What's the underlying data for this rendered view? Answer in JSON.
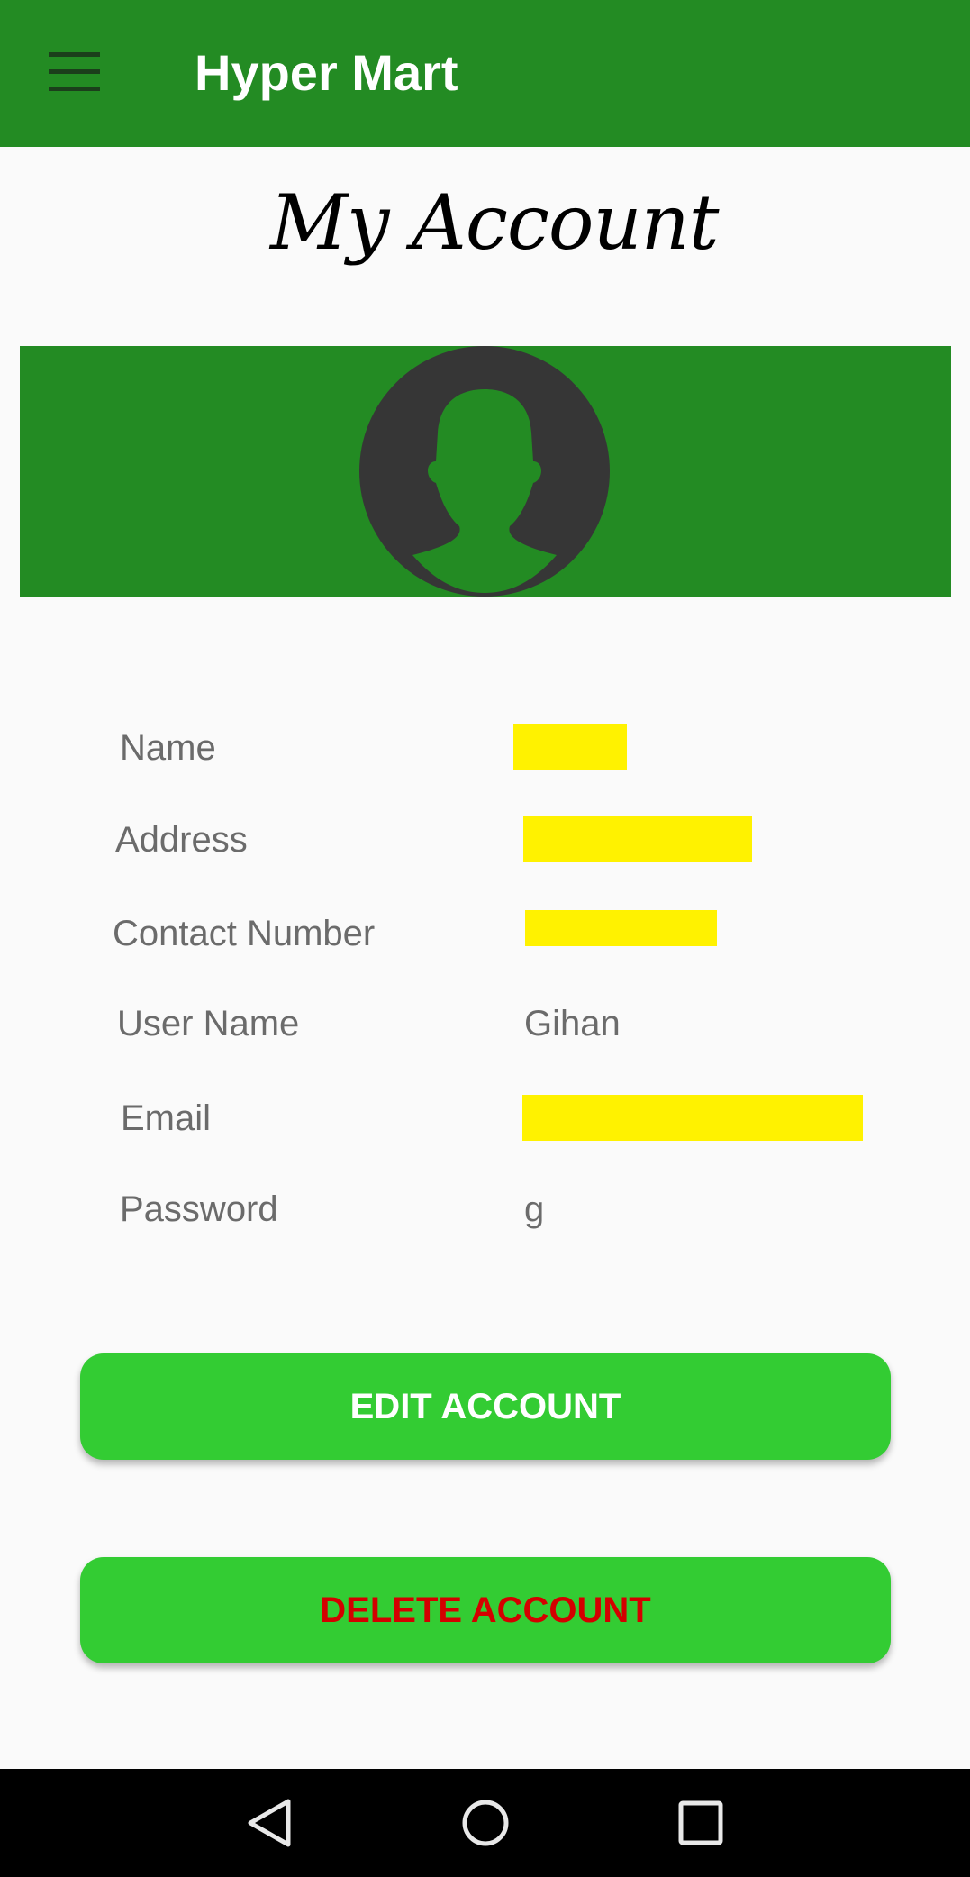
{
  "app_bar": {
    "title": "Hyper Mart",
    "menu_icon": "hamburger-menu-icon",
    "background": "#238b23"
  },
  "page": {
    "title": "My Account"
  },
  "profile": {
    "avatar_icon": "user-avatar-icon",
    "fields": [
      {
        "label": "Name",
        "value": ""
      },
      {
        "label": "Address",
        "value": ""
      },
      {
        "label": "Contact Number",
        "value": ""
      },
      {
        "label": "User Name",
        "value": "Gihan"
      },
      {
        "label": "Email",
        "value": ""
      },
      {
        "label": "Password",
        "value": "g"
      }
    ],
    "redaction_color": "#fff200"
  },
  "actions": {
    "edit_label": "EDIT ACCOUNT",
    "delete_label": "DELETE ACCOUNT",
    "button_color": "#33cc33",
    "delete_text_color": "#d40000"
  },
  "system_nav": {
    "back_icon": "back-triangle-icon",
    "home_icon": "home-circle-icon",
    "recents_icon": "recents-square-icon"
  }
}
